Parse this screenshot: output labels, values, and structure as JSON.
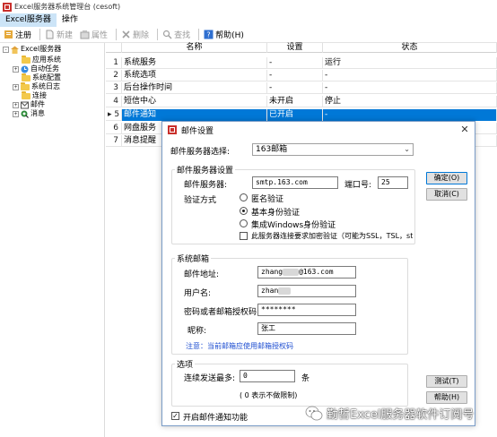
{
  "app": {
    "title": "Excel服务器系统管理台 (cesoft)"
  },
  "menu": {
    "items": [
      "Excel服务器",
      "操作"
    ]
  },
  "toolbar": {
    "register": "注册",
    "new": "新建",
    "properties": "属性",
    "delete": "删除",
    "find": "查找",
    "help": "帮助(H)"
  },
  "tree": {
    "root": "Excel服务器",
    "nodes": [
      "应用系统",
      "自动任务",
      "系统配置",
      "系统日志",
      "连接",
      "邮件",
      "消息"
    ],
    "collapsed_markers": [
      "+",
      "-"
    ]
  },
  "grid": {
    "headers": [
      "名称",
      "设置",
      "状态"
    ],
    "rows": [
      {
        "n": "1",
        "name": "系统服务",
        "setting": "-",
        "status": "运行"
      },
      {
        "n": "2",
        "name": "系统选项",
        "setting": "-",
        "status": "-"
      },
      {
        "n": "3",
        "name": "后台操作时间",
        "setting": "-",
        "status": "-"
      },
      {
        "n": "4",
        "name": "短信中心",
        "setting": "未开启",
        "status": "停止"
      },
      {
        "n": "5",
        "name": "邮件通知",
        "setting": "已开启",
        "status": "-"
      },
      {
        "n": "6",
        "name": "网盘服务",
        "setting": "",
        "status": ""
      },
      {
        "n": "7",
        "name": "消息提醒",
        "setting": "",
        "status": ""
      }
    ],
    "current_marker": "▸"
  },
  "dialog": {
    "title": "邮件设置",
    "close": "✕",
    "server_select_label": "邮件服务器选择:",
    "server_select_value": "163邮箱",
    "server_group": "邮件服务器设置",
    "server_label": "邮件服务器:",
    "server_value": "smtp.163.com",
    "port_label": "端口号:",
    "port_value": "25",
    "auth_label": "验证方式",
    "auth_options": [
      "匿名验证",
      "基本身份验证",
      "集成Windows身份验证"
    ],
    "auth_selected_index": 1,
    "encrypt_label": "此服务器连接要求加密验证（可能为SSL，TSL，start",
    "system_mail_group": "系统邮箱",
    "email_label": "邮件地址:",
    "email_prefix": "zhang",
    "email_suffix": "@163.com",
    "username_label": "用户名:",
    "username_value": "zhan",
    "password_label": "密码或者邮箱授权码",
    "password_value": "********",
    "nickname_label": "昵称:",
    "nickname_value": "张工",
    "note": "注意：当前邮箱应使用邮箱授权码",
    "options_group": "选项",
    "max_label": "连续发送最多:",
    "max_value": "0",
    "max_unit": "条",
    "max_note": "( 0 表示不做限制)",
    "enable_label": "开启邮件通知功能",
    "enable_checked": true,
    "ok": "确定(O)",
    "cancel": "取消(C)",
    "test": "测试(T)",
    "help": "帮助(H)"
  },
  "watermark": {
    "text": "勤哲Excel服务器软件订阅号"
  }
}
